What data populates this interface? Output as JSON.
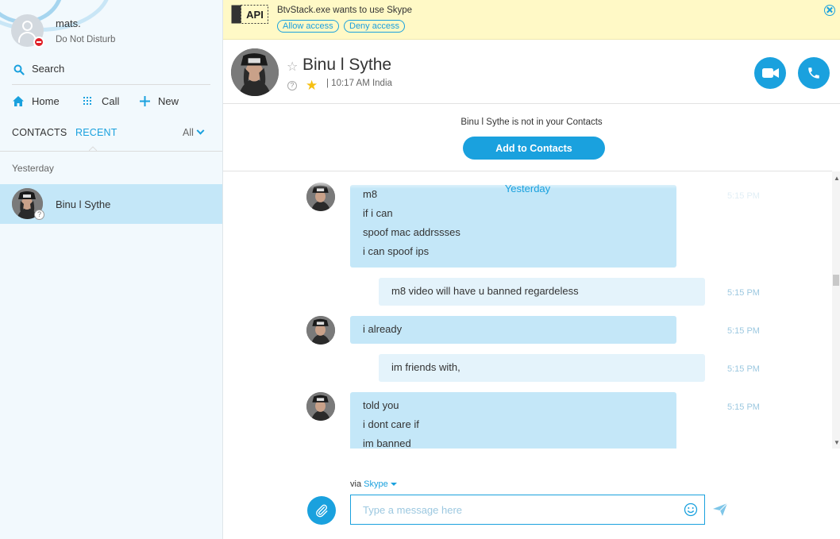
{
  "profile": {
    "name": "mats.",
    "status": "Do Not Disturb"
  },
  "sidebar": {
    "search_label": "Search",
    "nav": {
      "home": "Home",
      "call": "Call",
      "new": "New"
    },
    "tabs": {
      "contacts": "CONTACTS",
      "recent": "RECENT"
    },
    "filter": "All",
    "group_label": "Yesterday",
    "recent": [
      {
        "name": "Binu l Sythe"
      }
    ]
  },
  "notification": {
    "badge": "API",
    "message": "BtvStack.exe wants to use Skype",
    "allow": "Allow access",
    "deny": "Deny access"
  },
  "conversation": {
    "contact_name": "Binu l Sythe",
    "local_time": "| 10:17 AM India",
    "not_in_contacts": "Binu l Sythe is not in your Contacts",
    "add_button": "Add to Contacts",
    "day_label": "Yesterday",
    "messages": [
      {
        "dir": "in",
        "lines": [
          "m8",
          "if i can",
          "spoof mac addrssses",
          "i can spoof ips"
        ],
        "time": "5:15 PM"
      },
      {
        "dir": "out",
        "lines": [
          "m8 video will have u banned regardeless"
        ],
        "time": "5:15 PM"
      },
      {
        "dir": "in",
        "lines": [
          "i already"
        ],
        "time": "5:15 PM"
      },
      {
        "dir": "out",
        "lines": [
          "im friends with,"
        ],
        "time": "5:15 PM"
      },
      {
        "dir": "in",
        "lines": [
          "told you",
          "i dont care if",
          "im banned"
        ],
        "time": "5:15 PM"
      }
    ]
  },
  "composer": {
    "via": "via",
    "via_service": "Skype",
    "placeholder": "Type a message here"
  },
  "colors": {
    "accent": "#1aa1de",
    "sidebar_bg": "#f2f9fd",
    "selected_row": "#c4e7f8",
    "incoming_bubble": "#c4e7f8",
    "outgoing_bubble": "#e4f3fb",
    "notification_bg": "#fff9c6",
    "dnd_badge": "#e02028"
  }
}
